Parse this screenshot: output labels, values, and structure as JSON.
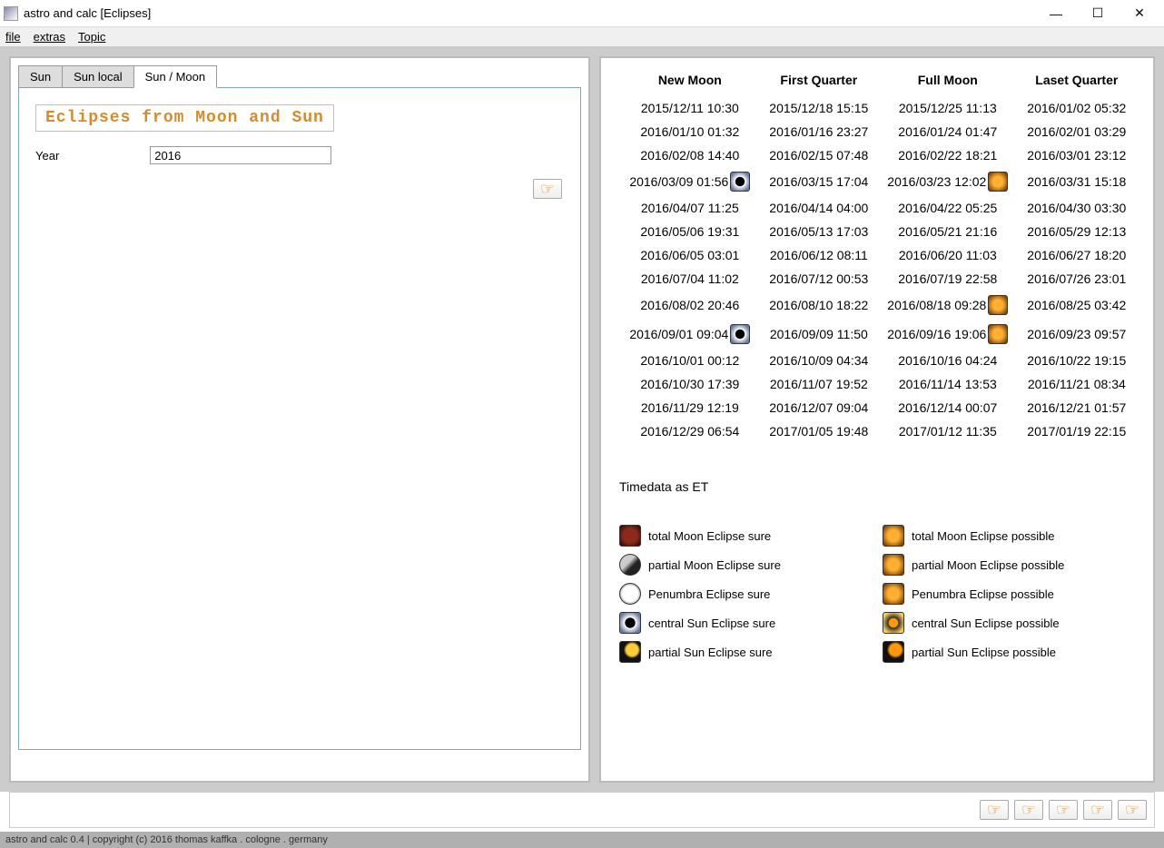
{
  "window": {
    "title": "astro and calc  [Eclipses]"
  },
  "menu": {
    "file": "file",
    "extras": "extras",
    "topic": "Topic"
  },
  "tabs": {
    "sun": "Sun",
    "sun_local": "Sun local",
    "sun_moon": "Sun / Moon"
  },
  "left": {
    "heading": "Eclipses from Moon and Sun",
    "year_label": "Year",
    "year_value": "2016"
  },
  "table": {
    "headers": [
      "New Moon",
      "First Quarter",
      "Full Moon",
      "Laset Quarter"
    ],
    "rows": [
      {
        "nm": "2015/12/11 10:30",
        "fq": "2015/12/18 15:15",
        "fm": "2015/12/25 11:13",
        "lq": "2016/01/02 05:32"
      },
      {
        "nm": "2016/01/10 01:32",
        "fq": "2016/01/16 23:27",
        "fm": "2016/01/24 01:47",
        "lq": "2016/02/01 03:29"
      },
      {
        "nm": "2016/02/08 14:40",
        "fq": "2016/02/15 07:48",
        "fm": "2016/02/22 18:21",
        "lq": "2016/03/01 23:12"
      },
      {
        "nm": "2016/03/09 01:56",
        "nm_icon": "sun-central",
        "fq": "2016/03/15 17:04",
        "fm": "2016/03/23 12:02",
        "fm_icon": "moon-possible",
        "lq": "2016/03/31 15:18"
      },
      {
        "nm": "2016/04/07 11:25",
        "fq": "2016/04/14 04:00",
        "fm": "2016/04/22 05:25",
        "lq": "2016/04/30 03:30"
      },
      {
        "nm": "2016/05/06 19:31",
        "fq": "2016/05/13 17:03",
        "fm": "2016/05/21 21:16",
        "lq": "2016/05/29 12:13"
      },
      {
        "nm": "2016/06/05 03:01",
        "fq": "2016/06/12 08:11",
        "fm": "2016/06/20 11:03",
        "lq": "2016/06/27 18:20"
      },
      {
        "nm": "2016/07/04 11:02",
        "fq": "2016/07/12 00:53",
        "fm": "2016/07/19 22:58",
        "lq": "2016/07/26 23:01"
      },
      {
        "nm": "2016/08/02 20:46",
        "fq": "2016/08/10 18:22",
        "fm": "2016/08/18 09:28",
        "fm_icon": "moon-possible",
        "lq": "2016/08/25 03:42"
      },
      {
        "nm": "2016/09/01 09:04",
        "nm_icon": "sun-central",
        "fq": "2016/09/09 11:50",
        "fm": "2016/09/16 19:06",
        "fm_icon": "moon-possible",
        "lq": "2016/09/23 09:57"
      },
      {
        "nm": "2016/10/01 00:12",
        "fq": "2016/10/09 04:34",
        "fm": "2016/10/16 04:24",
        "lq": "2016/10/22 19:15"
      },
      {
        "nm": "2016/10/30 17:39",
        "fq": "2016/11/07 19:52",
        "fm": "2016/11/14 13:53",
        "lq": "2016/11/21 08:34"
      },
      {
        "nm": "2016/11/29 12:19",
        "fq": "2016/12/07 09:04",
        "fm": "2016/12/14 00:07",
        "lq": "2016/12/21 01:57"
      },
      {
        "nm": "2016/12/29 06:54",
        "fq": "2017/01/05 19:48",
        "fm": "2017/01/12 11:35",
        "lq": "2017/01/19 22:15"
      }
    ]
  },
  "timedata": "Timedata as ET",
  "legend": [
    {
      "left_icon": "moon-total",
      "left": "total Moon Eclipse sure",
      "right_icon": "moon-possible",
      "right": "total Moon Eclipse possible"
    },
    {
      "left_icon": "moon-partial",
      "left": "partial Moon Eclipse sure",
      "right_icon": "moon-possible",
      "right": "partial Moon Eclipse possible"
    },
    {
      "left_icon": "penumbra",
      "left": "Penumbra Eclipse sure",
      "right_icon": "moon-possible",
      "right": "Penumbra Eclipse possible"
    },
    {
      "left_icon": "sun-central",
      "left": "central Sun Eclipse sure",
      "right_icon": "sun-central-poss",
      "right": "central Sun Eclipse possible"
    },
    {
      "left_icon": "sun-partial",
      "left": "partial Sun Eclipse sure",
      "right_icon": "sun-partial-poss",
      "right": "partial Sun Eclipse possible"
    }
  ],
  "statusbar": "astro and calc 0.4 | copyright (c) 2016 thomas kaffka . cologne . germany"
}
